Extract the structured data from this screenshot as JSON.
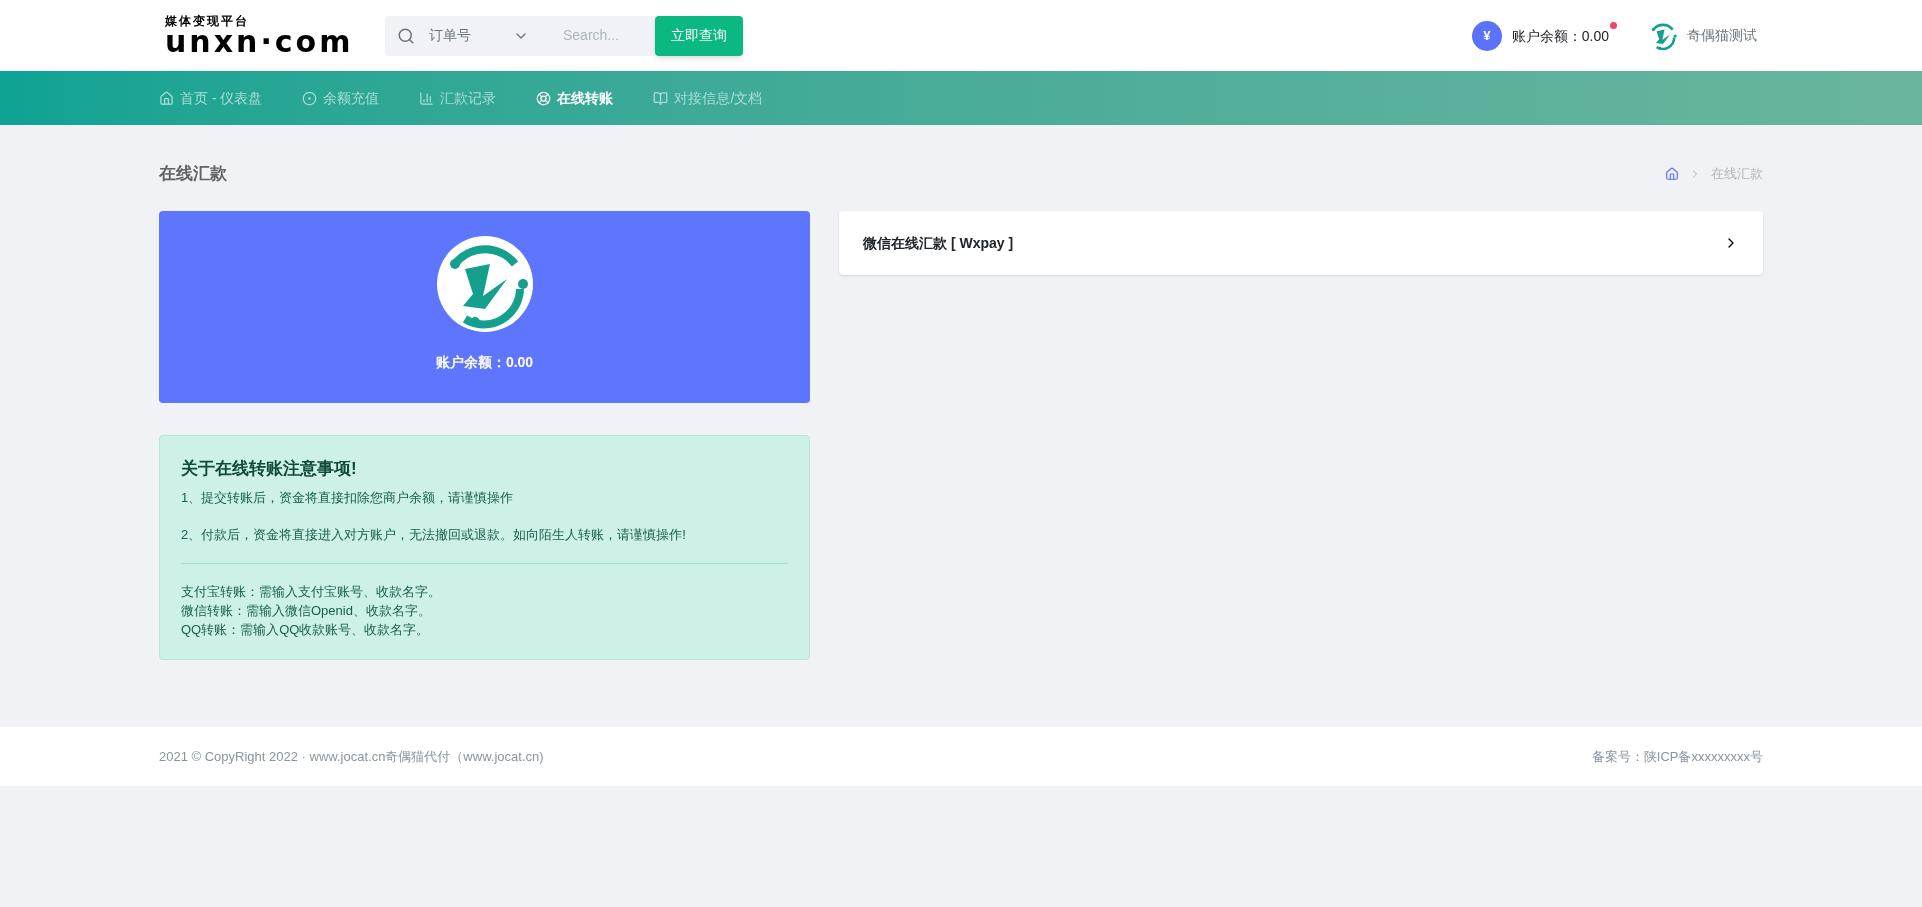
{
  "header": {
    "logo": {
      "tagline": "媒体变现平台",
      "wordmark": "unxn·com"
    },
    "search": {
      "filter": "订单号",
      "placeholder": "Search...",
      "button": "立即查询"
    },
    "balance": {
      "label": "账户余额：0.00",
      "currency": "¥",
      "notification": true
    },
    "user": {
      "name": "奇偶猫测试"
    }
  },
  "nav": [
    {
      "label": "首页 - 仪表盘",
      "selected": false
    },
    {
      "label": "余额充值",
      "selected": false
    },
    {
      "label": "汇款记录",
      "selected": false
    },
    {
      "label": "在线转账",
      "selected": true
    },
    {
      "label": "对接信息/文档",
      "selected": false
    }
  ],
  "page": {
    "title": "在线汇款",
    "breadcrumb": "在线汇款"
  },
  "account_card": {
    "balance": "账户余额：0.00"
  },
  "notice": {
    "title": "关于在线转账注意事项!",
    "points": [
      "1、提交转账后，资金将直接扣除您商户余额，请谨慎操作",
      "2、付款后，资金将直接进入对方账户，无法撤回或退款。如向陌生人转账，请谨慎操作!"
    ],
    "requirements": [
      "支付宝转账：需输入支付宝账号、收款名字。",
      "微信转账：需输入微信Openid、收款名字。",
      "QQ转账：需输入QQ收款账号、收款名字。"
    ]
  },
  "methods": [
    {
      "label": "微信在线汇款 [ Wxpay ]"
    }
  ],
  "footer": {
    "copyright": "2021 © CopyRight 2022 · www.jocat.cn奇偶猫代付（www.jocat.cn)",
    "icp": "备案号：陕ICP备xxxxxxxxx号"
  }
}
